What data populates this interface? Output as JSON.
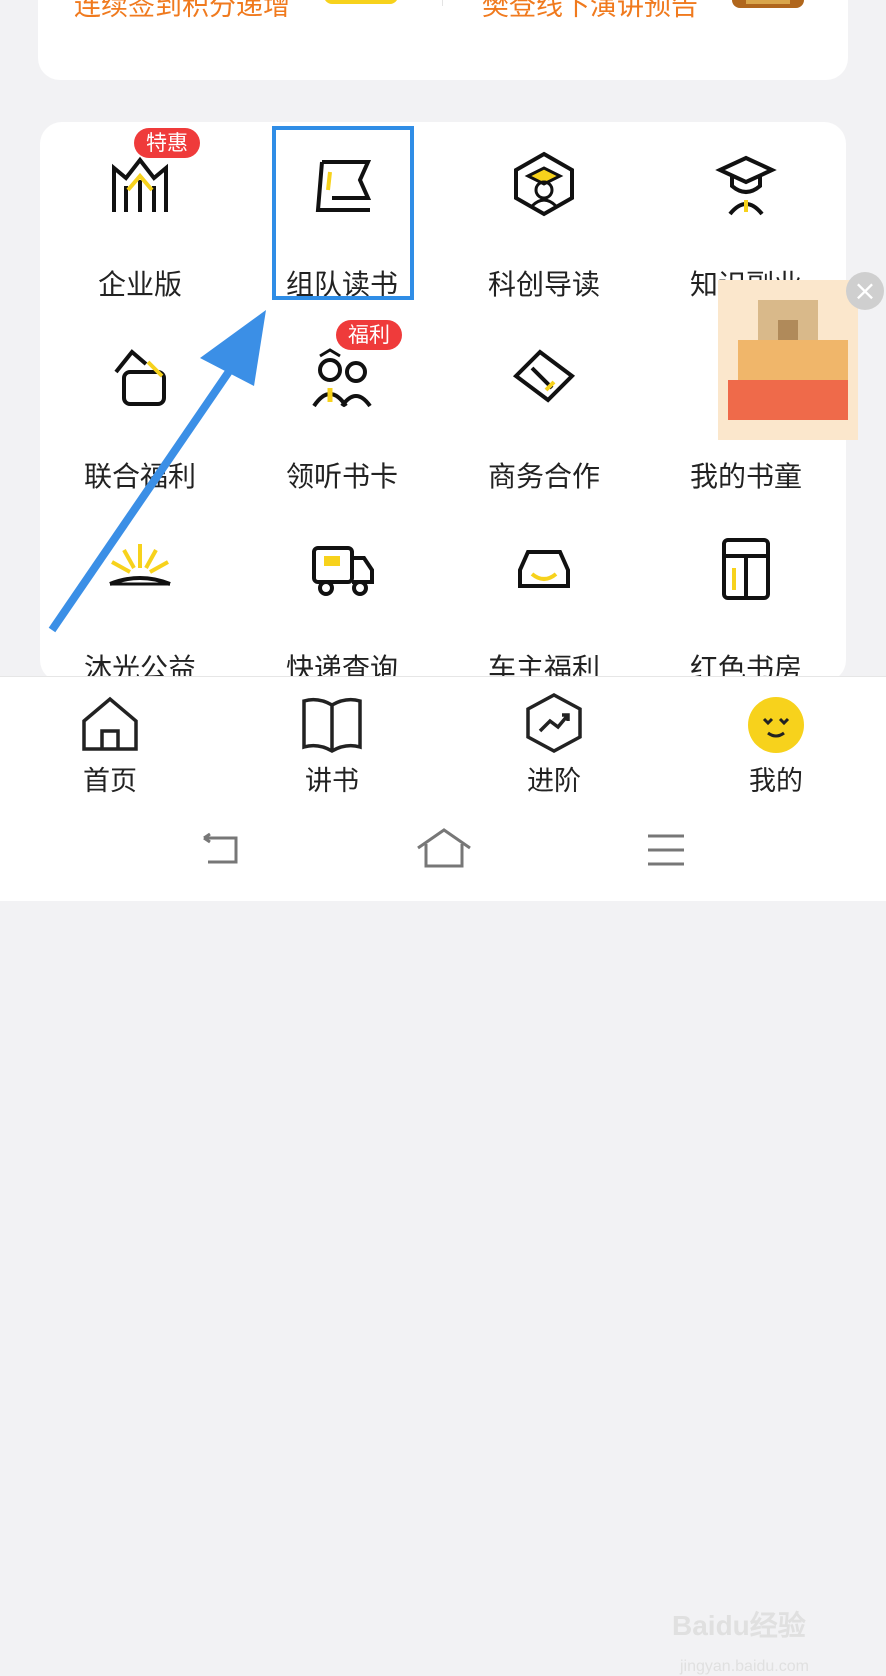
{
  "promo": {
    "left_text": "连续签到积分递增",
    "right_text": "樊登线下演讲预告"
  },
  "grid": {
    "items": [
      {
        "label": "企业版",
        "icon": "enterprise-icon",
        "tag": "特惠"
      },
      {
        "label": "组队读书",
        "icon": "flag-book-icon"
      },
      {
        "label": "科创导读",
        "icon": "graduate-hexagon-icon"
      },
      {
        "label": "知识副业",
        "icon": "graduate-cap-icon"
      },
      {
        "label": "联合福利",
        "icon": "gift-hand-icon"
      },
      {
        "label": "领听书卡",
        "icon": "people-card-icon",
        "tag": "福利"
      },
      {
        "label": "商务合作",
        "icon": "handshake-icon"
      },
      {
        "label": "我的书童",
        "icon": "book-boy-icon"
      },
      {
        "label": "沐光公益",
        "icon": "sunrise-book-icon"
      },
      {
        "label": "快递查询",
        "icon": "delivery-truck-icon"
      },
      {
        "label": "车主福利",
        "icon": "car-icon"
      },
      {
        "label": "红色书房",
        "icon": "bookshelf-icon"
      }
    ]
  },
  "tabbar": {
    "tabs": [
      {
        "label": "首页",
        "icon": "home-icon"
      },
      {
        "label": "讲书",
        "icon": "open-book-icon"
      },
      {
        "label": "进阶",
        "icon": "trend-hexagon-icon"
      },
      {
        "label": "我的",
        "icon": "smiley-avatar-icon"
      }
    ]
  },
  "watermark": {
    "brand": "Baidu经验",
    "url": "jingyan.baidu.com"
  },
  "colors": {
    "accent_yellow": "#f7d21c",
    "tag_red": "#ef3b3b",
    "highlight_blue": "#2f8de6",
    "arrow_blue": "#3b8fe6",
    "promo_orange": "#f07a1e"
  }
}
